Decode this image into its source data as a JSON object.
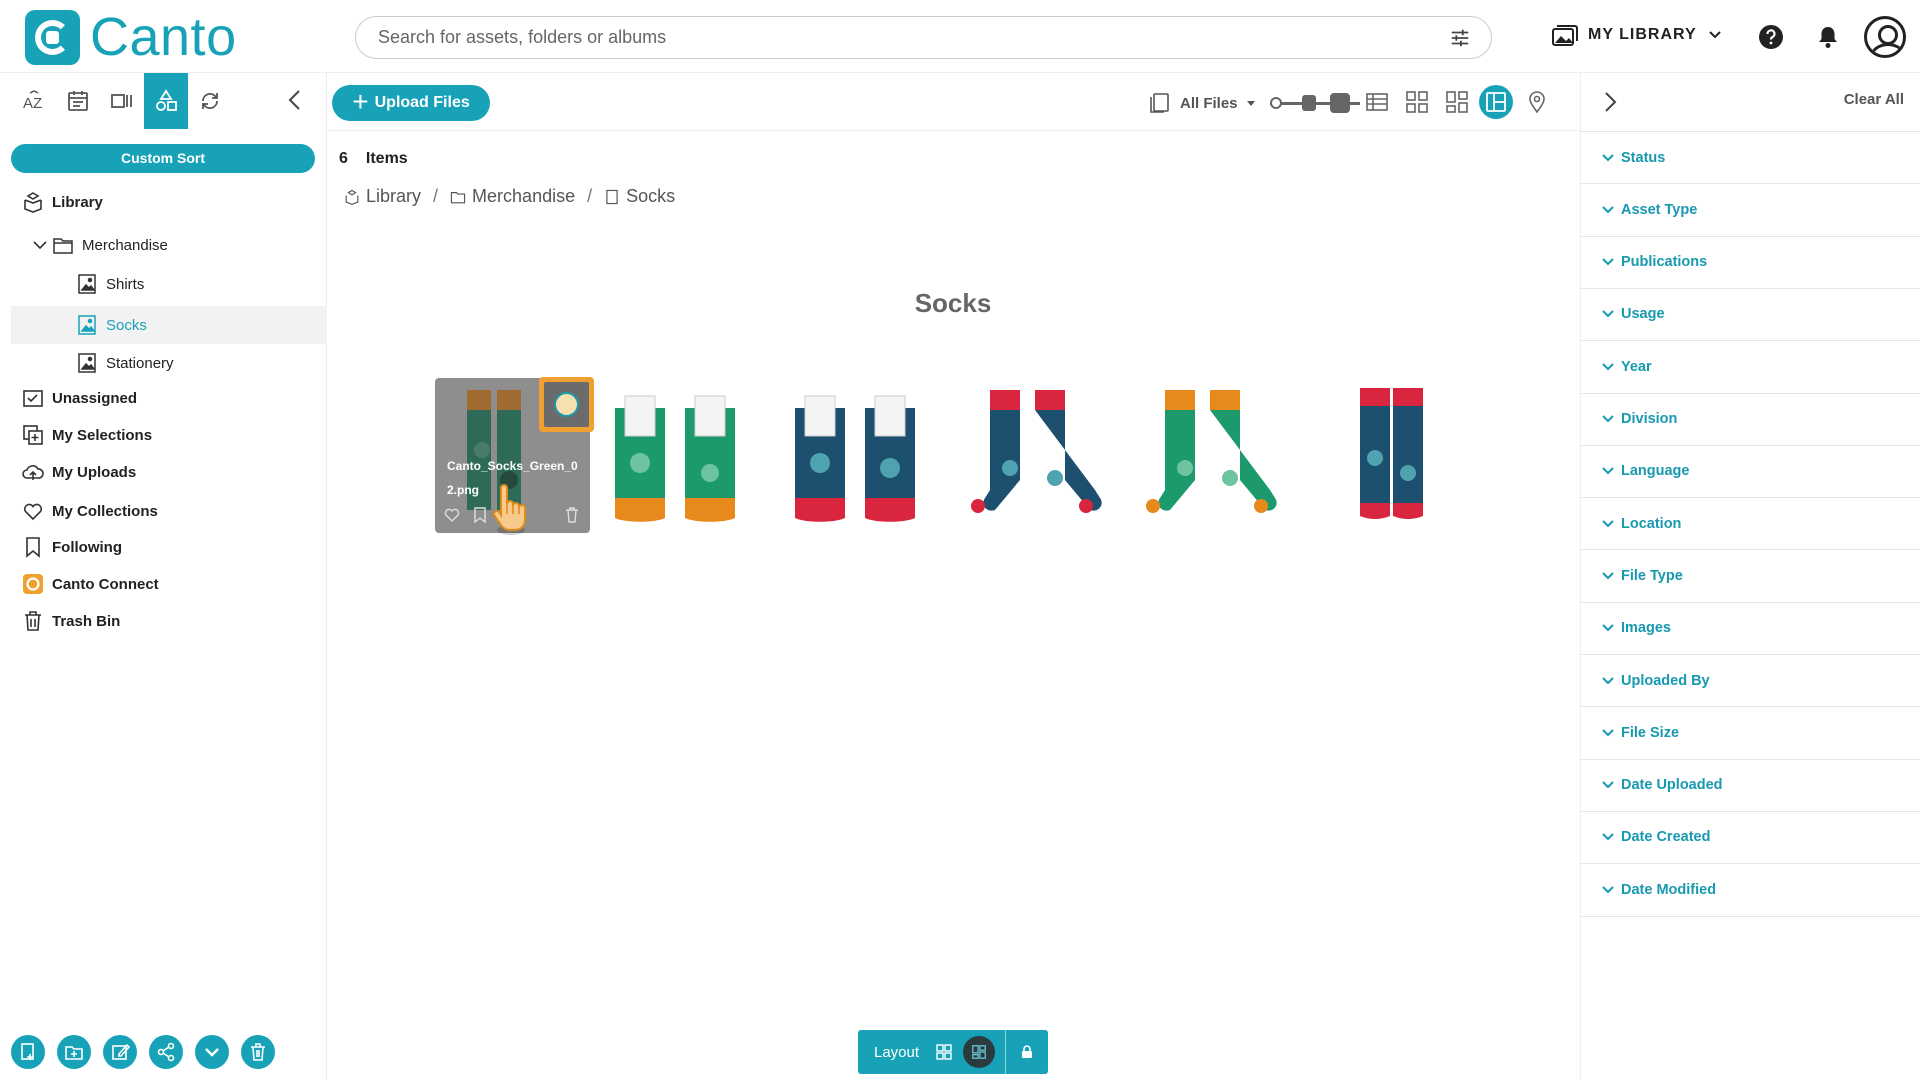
{
  "app": {
    "name": "Canto"
  },
  "search": {
    "placeholder": "Search for assets, folders or albums"
  },
  "header": {
    "library_switch": "MY LIBRARY"
  },
  "sidebar": {
    "custom_sort": "Custom Sort",
    "tree": [
      {
        "label": "Library"
      },
      {
        "label": "Merchandise"
      },
      {
        "label": "Shirts"
      },
      {
        "label": "Socks"
      },
      {
        "label": "Stationery"
      },
      {
        "label": "Unassigned"
      },
      {
        "label": "My Selections"
      },
      {
        "label": "My Uploads"
      },
      {
        "label": "My Collections"
      },
      {
        "label": "Following"
      },
      {
        "label": "Canto Connect"
      },
      {
        "label": "Trash Bin"
      }
    ]
  },
  "toolbar": {
    "upload": "Upload Files",
    "filter": "All Files"
  },
  "content": {
    "count": "6",
    "count_label": "Items",
    "breadcrumb": [
      "Library",
      "Merchandise",
      "Socks"
    ],
    "album_title": "Socks",
    "hovered_file": "Canto_Socks_Green_02.png",
    "thumbnails": [
      {
        "colors": [
          "#1a8f6a",
          "#e38a1c"
        ],
        "style": "flat"
      },
      {
        "colors": [
          "#1d9a6c",
          "#e8891b"
        ],
        "style": "flat"
      },
      {
        "colors": [
          "#1d4f6e",
          "#d9253e"
        ],
        "style": "flat"
      },
      {
        "colors": [
          "#1d4f6e",
          "#d9253e"
        ],
        "style": "worn"
      },
      {
        "colors": [
          "#1d9a6c",
          "#e8891b"
        ],
        "style": "worn"
      },
      {
        "colors": [
          "#1d4f6e",
          "#d9253e"
        ],
        "style": "front"
      }
    ]
  },
  "layout_bar": {
    "label": "Layout"
  },
  "filters": {
    "clear": "Clear All",
    "items": [
      "Status",
      "Asset Type",
      "Publications",
      "Usage",
      "Year",
      "Division",
      "Language",
      "Location",
      "File Type",
      "Images",
      "Uploaded By",
      "File Size",
      "Date Uploaded",
      "Date Created",
      "Date Modified"
    ]
  },
  "colors": {
    "accent": "#17a2b8",
    "highlight": "#f0a030"
  }
}
